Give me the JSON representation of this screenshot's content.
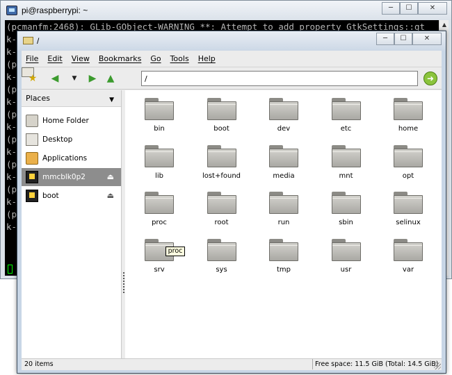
{
  "terminal": {
    "title": "pi@raspberrypi: ~",
    "first_line": "(pcmanfm:2468): GLib-GObject-WARNING **: Attempt to add property GtkSettings::gt",
    "left_fragments": [
      "k-",
      "k-",
      "(p",
      "k-",
      "(p",
      "k-",
      "(p",
      "k-",
      "(p",
      "k-",
      "(p",
      "k-",
      "(p",
      "k-",
      "(p",
      "k-"
    ],
    "caption_icons": {
      "minimize": "minimize-icon",
      "maximize": "maximize-icon",
      "close": "close-icon"
    }
  },
  "file_manager": {
    "title": "/",
    "menu": [
      "File",
      "Edit",
      "View",
      "Bookmarks",
      "Go",
      "Tools",
      "Help"
    ],
    "path": "/",
    "places_label": "Places",
    "places": [
      {
        "label": "Home Folder",
        "icon": "home-folder-icon",
        "selected": false,
        "eject": false
      },
      {
        "label": "Desktop",
        "icon": "desktop-icon",
        "selected": false,
        "eject": false
      },
      {
        "label": "Applications",
        "icon": "applications-icon",
        "selected": false,
        "eject": false
      },
      {
        "label": "mmcblk0p2",
        "icon": "sd-card-icon",
        "selected": true,
        "eject": true
      },
      {
        "label": "boot",
        "icon": "sd-card-icon",
        "selected": false,
        "eject": true
      }
    ],
    "folders": [
      "bin",
      "boot",
      "dev",
      "etc",
      "home",
      "lib",
      "lost+found",
      "media",
      "mnt",
      "opt",
      "proc",
      "root",
      "run",
      "sbin",
      "selinux",
      "srv",
      "sys",
      "tmp",
      "usr",
      "var"
    ],
    "tooltip": "proc",
    "status_count": "20 items",
    "status_free": "Free space: 11.5 GiB (Total: 14.5 GiB)",
    "accent_selected": "#8d8d8d",
    "folder_color": "#c0bfba"
  }
}
